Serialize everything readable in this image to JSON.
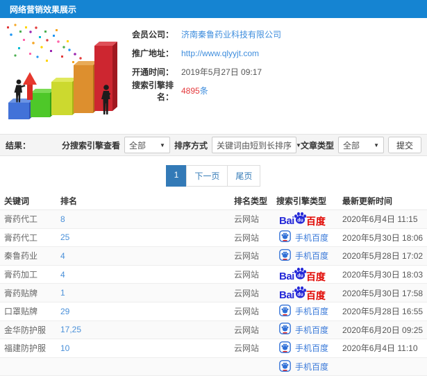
{
  "header": {
    "title": "网络营销效果展示"
  },
  "info": {
    "rows": [
      {
        "label": "会员公司：",
        "value": "济南秦鲁药业科技有限公司"
      },
      {
        "label": "推广地址：",
        "value": "http://www.qlyyjt.com"
      },
      {
        "label": "开通时间：",
        "value": "2019年5月27日 09:17"
      },
      {
        "label": "搜索引擎排名：",
        "value": "4895",
        "suffix": "条"
      }
    ]
  },
  "filters": {
    "result_label": "结果：",
    "engine_label": "分搜索引擎查看",
    "engine_value": "全部",
    "sort_label": "排序方式",
    "sort_value": "关键词由短到长排序",
    "article_label": "文章类型",
    "article_value": "全部",
    "submit_label": "提交"
  },
  "pagination": {
    "current": "1",
    "next": "下一页",
    "last": "尾页"
  },
  "table": {
    "headers": [
      "关键词",
      "排名",
      "排名类型",
      "搜索引擎类型",
      "最新更新时间"
    ],
    "engine_labels": {
      "baidu_bai": "Bai",
      "baidu_du": "du",
      "baidu_cn": "百度",
      "mobile_cn": "手机百度"
    },
    "rows": [
      {
        "keyword": "膏药代工",
        "rank": "8",
        "rank_type": "云网站",
        "engine": "baidu",
        "time": "2020年6月4日 11:15"
      },
      {
        "keyword": "膏药代工",
        "rank": "25",
        "rank_type": "云网站",
        "engine": "mobile",
        "time": "2020年5月30日 18:06"
      },
      {
        "keyword": "秦鲁药业",
        "rank": "4",
        "rank_type": "云网站",
        "engine": "mobile",
        "time": "2020年5月28日 17:02"
      },
      {
        "keyword": "膏药加工",
        "rank": "4",
        "rank_type": "云网站",
        "engine": "baidu",
        "time": "2020年5月30日 18:03"
      },
      {
        "keyword": "膏药贴牌",
        "rank": "1",
        "rank_type": "云网站",
        "engine": "baidu",
        "time": "2020年5月30日 17:58"
      },
      {
        "keyword": "口罩贴牌",
        "rank": "29",
        "rank_type": "云网站",
        "engine": "mobile",
        "time": "2020年5月28日 16:55"
      },
      {
        "keyword": "金华防护服",
        "rank": "17,25",
        "rank_type": "云网站",
        "engine": "mobile",
        "time": "2020年6月20日 09:25"
      },
      {
        "keyword": "福建防护服",
        "rank": "10",
        "rank_type": "云网站",
        "engine": "mobile",
        "time": "2020年6月4日 11:10"
      }
    ],
    "partial_row": {
      "engine": "mobile"
    }
  },
  "colors": {
    "accent": "#1584d2",
    "link": "#3e8ddd",
    "rank": "#4a90d9",
    "danger": "#e4393c",
    "baidu-blue": "#2529d8",
    "baidu-red": "#e10601",
    "page-active": "#337ab7"
  }
}
